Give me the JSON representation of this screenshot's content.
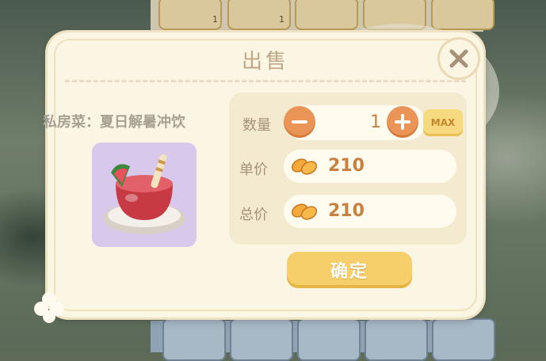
{
  "dialog": {
    "title": "出售",
    "item_name": "私房菜：夏日解暑冲饮",
    "quantity_label": "数量",
    "quantity_value": "1",
    "max_label": "MAX",
    "unit_price_label": "单价",
    "unit_price_value": "210",
    "total_price_label": "总价",
    "total_price_value": "210",
    "confirm_label": "确定"
  },
  "background": {
    "top_counts": [
      "1",
      "1"
    ]
  },
  "icons": {
    "close": "close-icon",
    "minus": "minus-icon",
    "plus": "plus-icon",
    "coin": "coin-icon",
    "item": "summer-drink-icon"
  },
  "colors": {
    "dialog_bg": "#fbf5e3",
    "accent_orange": "#ea9457",
    "confirm_yellow": "#f7cf6a",
    "item_bg": "#d7c8ec"
  }
}
